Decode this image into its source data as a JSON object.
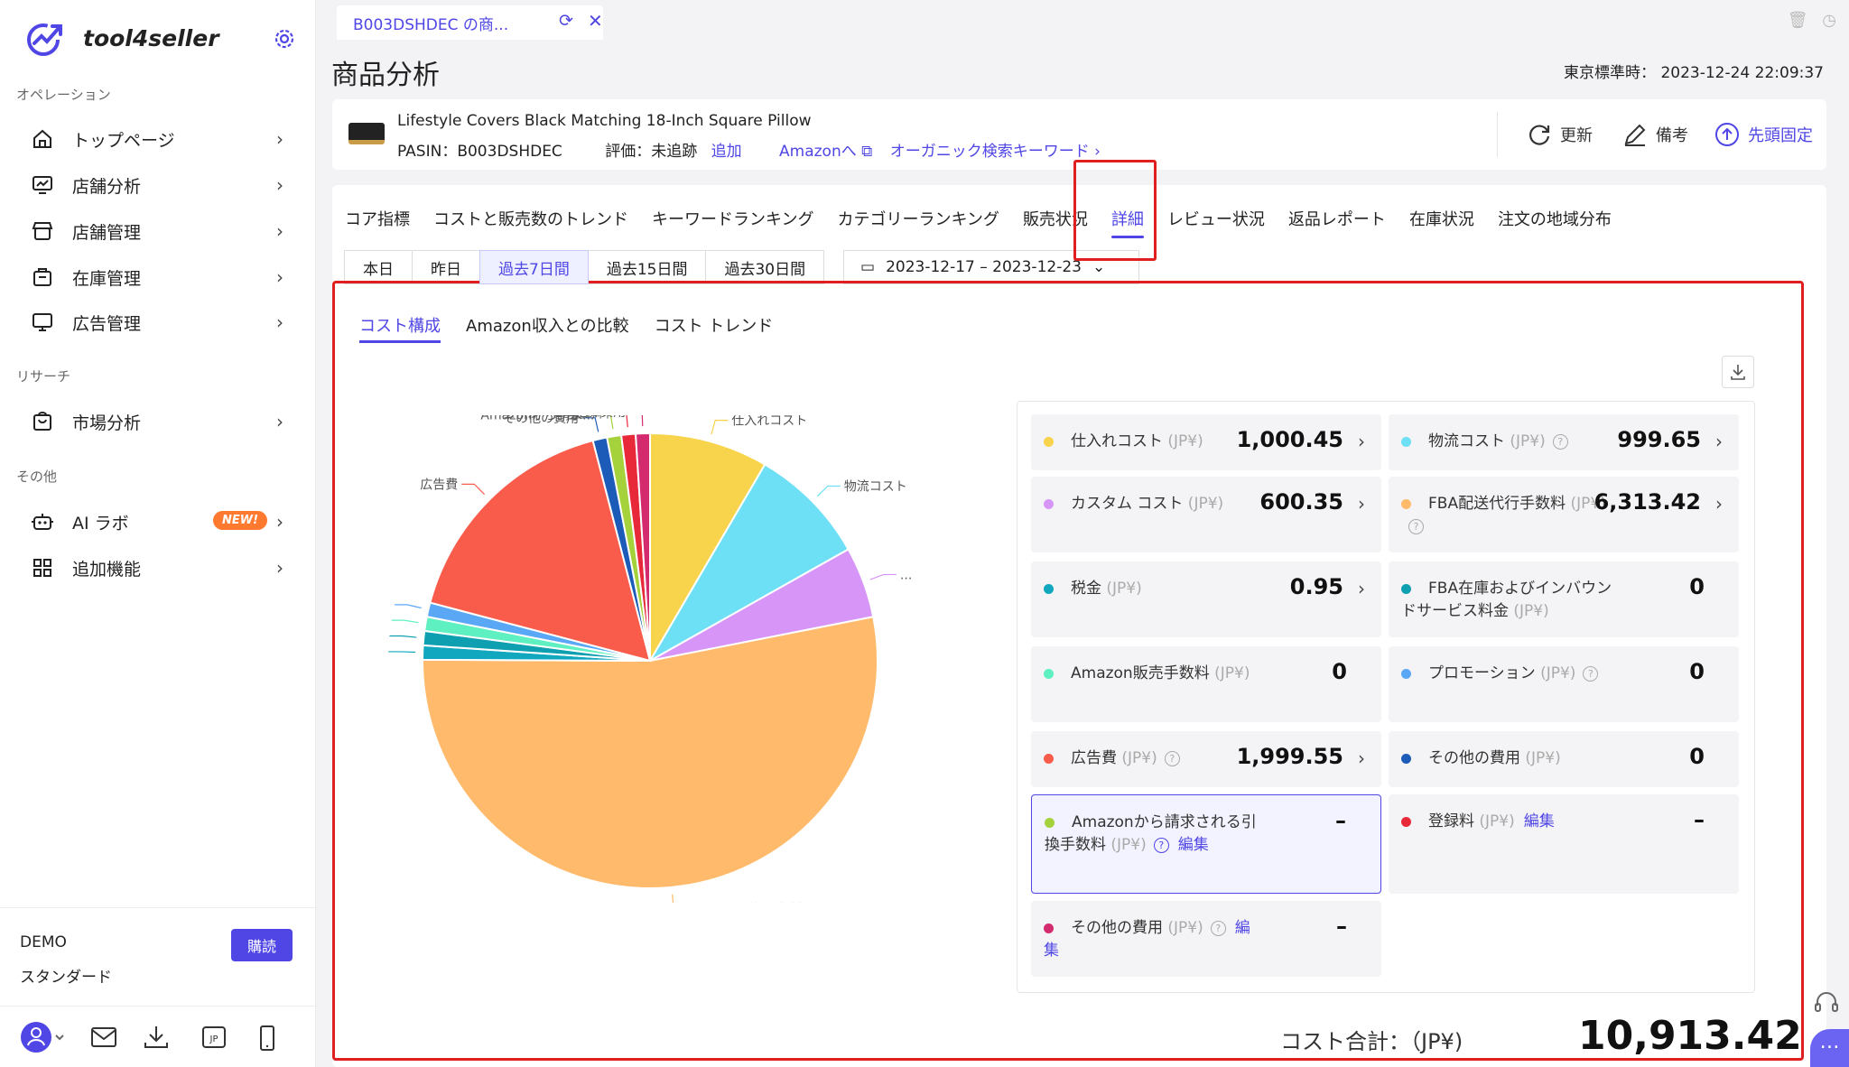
{
  "app": {
    "name": "tool4seller"
  },
  "sidebar": {
    "sections": [
      {
        "label": "オペレーション",
        "items": [
          {
            "label": "トップページ",
            "icon": "home-icon"
          },
          {
            "label": "店舗分析",
            "icon": "store-analysis-icon"
          },
          {
            "label": "店舗管理",
            "icon": "store-icon"
          },
          {
            "label": "在庫管理",
            "icon": "inventory-icon"
          },
          {
            "label": "広告管理",
            "icon": "monitor-icon"
          }
        ]
      },
      {
        "label": "リサーチ",
        "items": [
          {
            "label": "市場分析",
            "icon": "market-icon"
          }
        ]
      },
      {
        "label": "その他",
        "items": [
          {
            "label": "AI ラボ",
            "icon": "robot-icon",
            "badge": "NEW!"
          },
          {
            "label": "追加機能",
            "icon": "grid-icon"
          }
        ]
      }
    ],
    "account": {
      "name": "DEMO",
      "plan": "スタンダード",
      "buy_label": "購読"
    },
    "bottom_icons": [
      "user-icon",
      "mail-icon",
      "download-icon",
      "jp-icon",
      "mobile-icon"
    ],
    "jp_label": "JP"
  },
  "tabbar": {
    "doc_tab": "B003DSHDEC の商..."
  },
  "page": {
    "title": "商品分析",
    "clock_label": "東京標準時：",
    "clock_value": "2023-12-24 22:09:37"
  },
  "product": {
    "title": "Lifestyle Covers Black Matching 18-Inch Square Pillow",
    "pasin_label": "PASIN：",
    "pasin": "B003DSHDEC",
    "rating_label": "評価：未追跡",
    "add_label": "追加",
    "amazon_link": "Amazonへ",
    "organic_link": "オーガニック検索キーワード",
    "actions": {
      "refresh": "更新",
      "note": "備考",
      "pin": "先頭固定"
    }
  },
  "main_tabs": [
    {
      "label": "コア指標"
    },
    {
      "label": "コストと販売数のトレンド"
    },
    {
      "label": "キーワードランキング"
    },
    {
      "label": "カテゴリーランキング"
    },
    {
      "label": "販売状況"
    },
    {
      "label": "詳細",
      "active": true
    },
    {
      "label": "レビュー状況"
    },
    {
      "label": "返品レポート"
    },
    {
      "label": "在庫状況"
    },
    {
      "label": "注文の地域分布"
    }
  ],
  "ranges": [
    {
      "label": "本日"
    },
    {
      "label": "昨日"
    },
    {
      "label": "過去7日間",
      "active": true
    },
    {
      "label": "過去15日間"
    },
    {
      "label": "過去30日間"
    }
  ],
  "date_range": "2023-12-17 – 2023-12-23",
  "sub_tabs": [
    {
      "label": "コスト構成",
      "active": true
    },
    {
      "label": "Amazon収入との比較"
    },
    {
      "label": "コスト トレンド"
    }
  ],
  "costs": [
    {
      "label": "仕入れコスト",
      "unit": "(JP¥)",
      "value": "1,000.45",
      "color": "#f7d44c",
      "chev": true
    },
    {
      "label": "物流コスト",
      "unit": "(JP¥)",
      "value": "999.65",
      "color": "#6ee0f5",
      "chev": true,
      "help": true
    },
    {
      "label": "カスタム コスト",
      "unit": "(JP¥)",
      "value": "600.35",
      "color": "#d796f7",
      "chev": true
    },
    {
      "label": "FBA配送代行手数料",
      "unit": "(JP¥)",
      "value": "6,313.42",
      "color": "#ffba6b",
      "chev": true,
      "help": true
    },
    {
      "label": "税金",
      "unit": "(JP¥)",
      "value": "0.95",
      "color": "#11a8bf",
      "chev": true
    },
    {
      "label": "FBA在庫およびインバウンドサービス料金",
      "unit": "(JP¥)",
      "value": "0",
      "color": "#0e9fb0"
    },
    {
      "label": "Amazon販売手数料",
      "unit": "(JP¥)",
      "value": "0",
      "color": "#5ef0c0"
    },
    {
      "label": "プロモーション",
      "unit": "(JP¥)",
      "value": "0",
      "color": "#5aa8f5",
      "help": true
    },
    {
      "label": "広告費",
      "unit": "(JP¥)",
      "value": "1,999.55",
      "color": "#fa5c4c",
      "chev": true,
      "help": true
    },
    {
      "label": "その他の費用",
      "unit": "(JP¥)",
      "value": "0",
      "color": "#1c5cb8"
    },
    {
      "label": "Amazonから請求される引換手数料",
      "unit": "(JP¥)",
      "value": "–",
      "color": "#a5d13a",
      "help": true,
      "edit": "編集",
      "selected": true
    },
    {
      "label": "登録料",
      "unit": "(JP¥)",
      "value": "–",
      "color": "#e8293a",
      "edit": "編集"
    },
    {
      "label": "その他の費用",
      "unit": "(JP¥)",
      "value": "–",
      "color": "#d42a6e",
      "help": true,
      "edit": "編集"
    }
  ],
  "total": {
    "label": "コスト合計：（JP¥)",
    "value": "10,913.42"
  },
  "chart_data": {
    "type": "pie",
    "slices": [
      {
        "label": "仕入れコスト",
        "value": 1000.45,
        "color": "#f7d44c"
      },
      {
        "label": "物流コスト",
        "value": 999.65,
        "color": "#6ee0f5"
      },
      {
        "label": "...",
        "value": 600.35,
        "color": "#d796f7"
      },
      {
        "label": "FBA配送代行手数料",
        "value": 6313.42,
        "color": "#ffba6b"
      },
      {
        "label": "",
        "value": 120,
        "color": "#11a8bf"
      },
      {
        "label": "",
        "value": 120,
        "color": "#0e9fb0"
      },
      {
        "label": "",
        "value": 120,
        "color": "#5ef0c0"
      },
      {
        "label": "",
        "value": 120,
        "color": "#5aa8f5"
      },
      {
        "label": "広告費",
        "value": 1999.55,
        "color": "#fa5c4c"
      },
      {
        "label": "その他の費用",
        "value": 120,
        "color": "#1c5cb8"
      },
      {
        "label": "Amazonから請求...",
        "value": 120,
        "color": "#a5d13a"
      },
      {
        "label": "登録料",
        "value": 120,
        "color": "#e8293a"
      },
      {
        "label": "その他の費用",
        "value": 120,
        "color": "#d42a6e"
      }
    ]
  }
}
